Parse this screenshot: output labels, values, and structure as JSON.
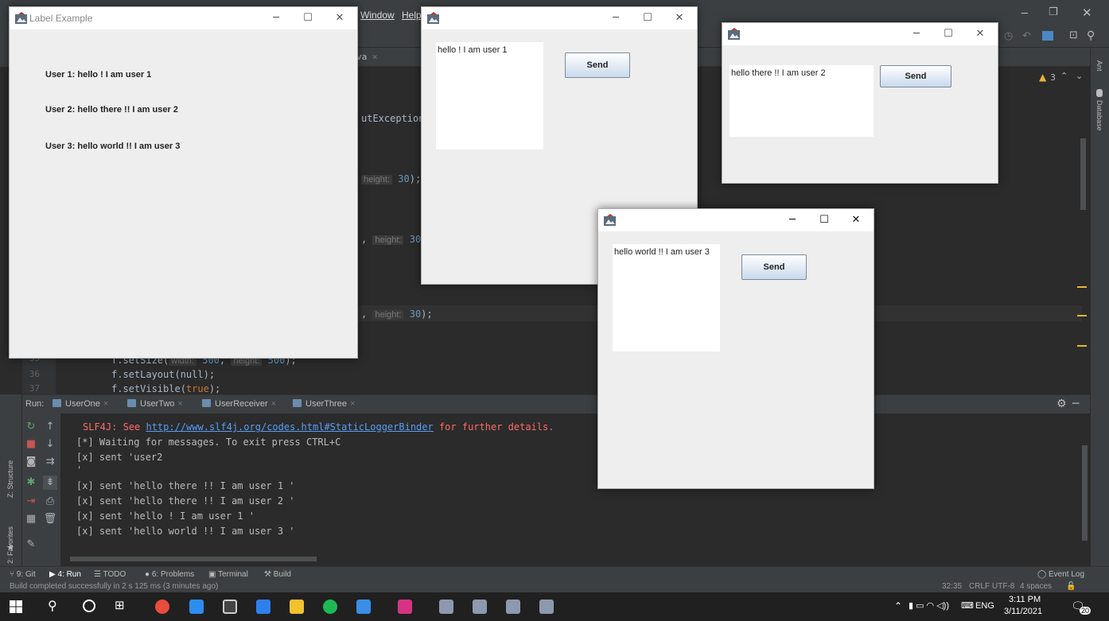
{
  "ide": {
    "menu_window": "Window",
    "menu_help": "Help",
    "editor_tab_fragment": "va",
    "code_fragment_exception": "utException",
    "code_hint_height": "height:",
    "code_val_30": "30",
    "code_paren": ");",
    "line_35": "35",
    "line_36": "36",
    "line_37": "37",
    "code_35_prefix": "f.setSize(",
    "code_35_hint_width": "width:",
    "code_35_val_width": "500",
    "code_35_hint_height": "height:",
    "code_35_val_height": "500",
    "code_36": "f.setLayout(null);",
    "code_37_prefix": "f.setVisible(",
    "code_37_true": "true",
    "code_37_suffix": ");",
    "warning_count": "3",
    "right_strip_ant": "Ant",
    "right_strip_database": "Database",
    "left_strip_structure": "Z: Structure",
    "left_strip_favorites": "2: Favorites"
  },
  "run_panel": {
    "label": "Run:",
    "tabs": [
      "UserOne",
      "UserTwo",
      "UserReceiver",
      "UserThree"
    ],
    "console_lines": {
      "slf4j_prefix": "SLF4J: See ",
      "slf4j_link": "http://www.slf4j.org/codes.html#StaticLoggerBinder",
      "slf4j_suffix": " for further details.",
      "l1": "[*] Waiting for messages. To exit press CTRL+C",
      "l2": "[x] sent 'user2",
      "l3": "'",
      "l4": "[x] sent 'hello there !! I am user 1 '",
      "l5": "[x] sent 'hello there !! I am user 2 '",
      "l6": "[x] sent 'hello ! I am user 1 '",
      "l7": "[x] sent 'hello world !! I am user 3 '"
    }
  },
  "bottom_tools": {
    "git": "9: Git",
    "run": "4: Run",
    "todo": "TODO",
    "problems": "6: Problems",
    "terminal": "Terminal",
    "build": "Build",
    "event_log": "Event Log"
  },
  "status_bar": {
    "message": "Build completed successfully in 2 s 125 ms (3 minutes ago)",
    "position": "32:35",
    "line_sep": "CRLF",
    "encoding": "UTF-8",
    "indent": "4 spaces"
  },
  "taskbar": {
    "language": "ENG",
    "time": "3:11 PM",
    "date": "3/11/2021",
    "notifications": "20"
  },
  "windows": {
    "label_example": {
      "title": "Label Example",
      "labels": [
        "User 1: hello ! I am user 1",
        "User 2: hello there !! I am user 2",
        "User 3: hello world !! I am user 3"
      ]
    },
    "user1": {
      "message": "hello ! I am user 1",
      "send_label": "Send"
    },
    "user2": {
      "message": "hello there !! I am user 2",
      "send_label": "Send"
    },
    "user3": {
      "message": "hello world !! I am user 3",
      "send_label": "Send"
    }
  },
  "colors": {
    "ide_bg": "#2b2b2b",
    "ide_panel": "#3c3f41",
    "error_red": "#ff6b68",
    "link_blue": "#589df6",
    "warning_yellow": "#e8b53a"
  }
}
